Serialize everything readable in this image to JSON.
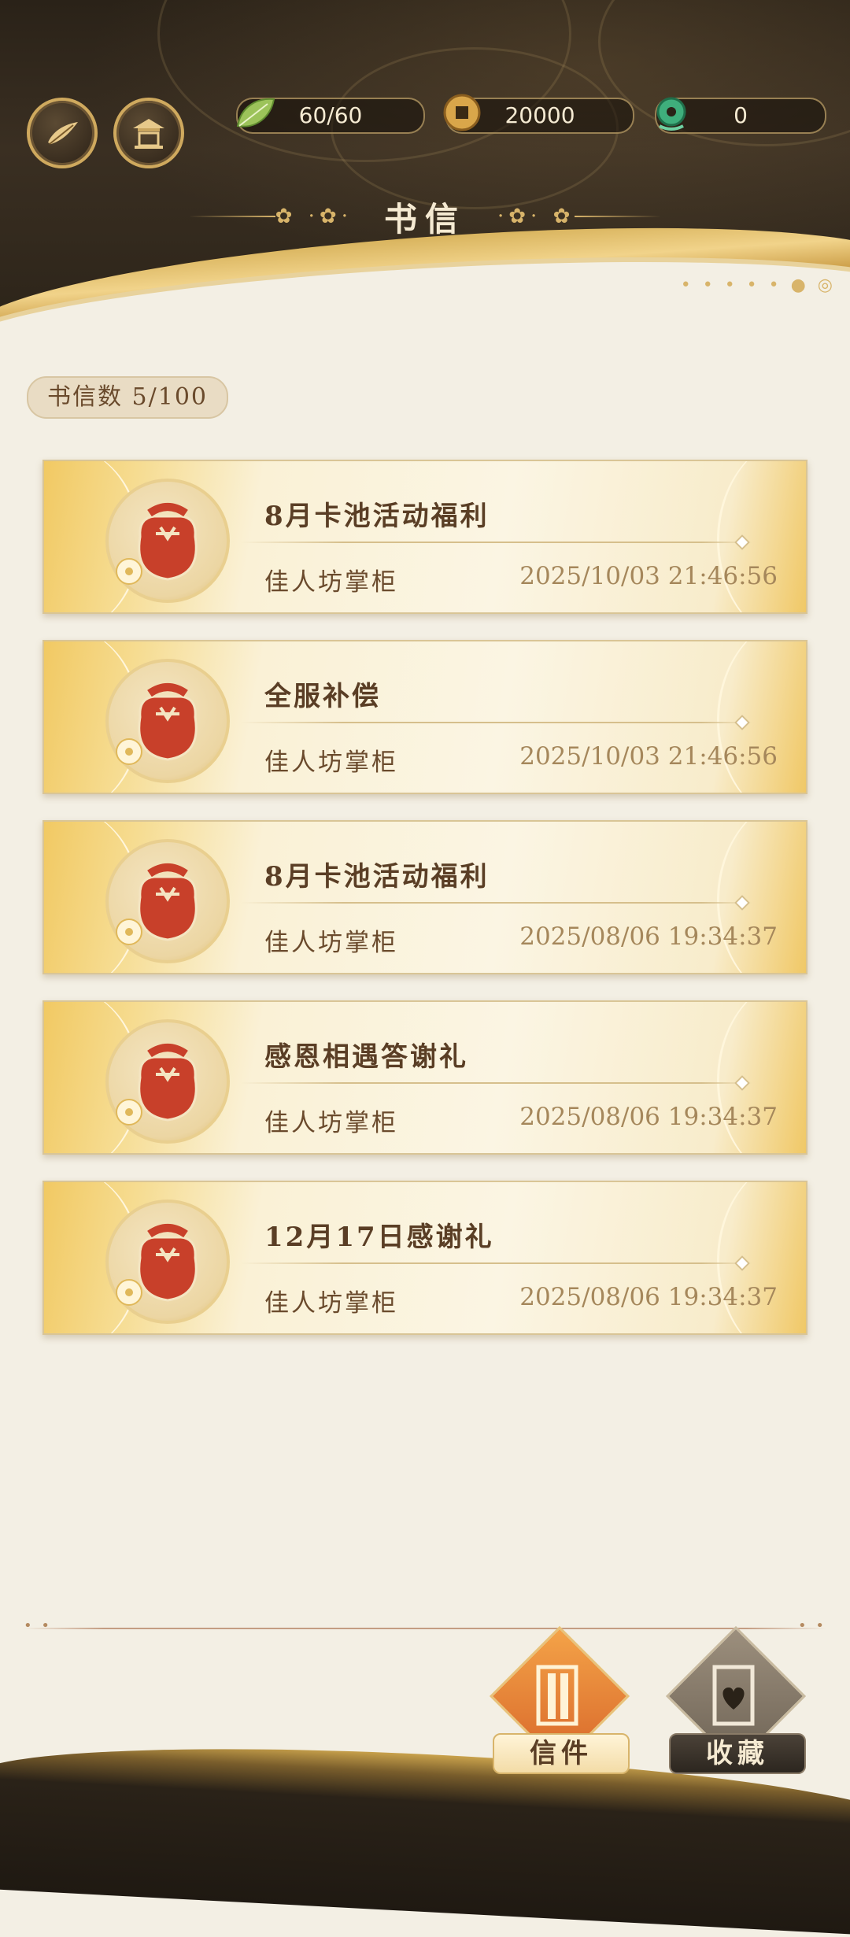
{
  "header": {
    "title": "书信",
    "resources": [
      {
        "icon": "leaf-stamina-icon",
        "value": "60/60"
      },
      {
        "icon": "copper-coin-icon",
        "value": "20000"
      },
      {
        "icon": "jade-pendant-icon",
        "value": "0"
      }
    ]
  },
  "mail_count": {
    "label": "书信数 5/100"
  },
  "mails": [
    {
      "title": "8月卡池活动福利",
      "sender": "佳人坊掌柜",
      "time": "2025/10/03 21:46:56"
    },
    {
      "title": "全服补偿",
      "sender": "佳人坊掌柜",
      "time": "2025/10/03 21:46:56"
    },
    {
      "title": "8月卡池活动福利",
      "sender": "佳人坊掌柜",
      "time": "2025/08/06 19:34:37"
    },
    {
      "title": "感恩相遇答谢礼",
      "sender": "佳人坊掌柜",
      "time": "2025/08/06 19:34:37"
    },
    {
      "title": "12月17日感谢礼",
      "sender": "佳人坊掌柜",
      "time": "2025/08/06 19:34:37"
    }
  ],
  "tabs": {
    "mail": "信件",
    "collection": "收藏"
  },
  "colors": {
    "header_dark": "#2a2218",
    "gold": "#d8b46a",
    "active_tab": "#e8813a",
    "seal_red": "#c8402a"
  }
}
